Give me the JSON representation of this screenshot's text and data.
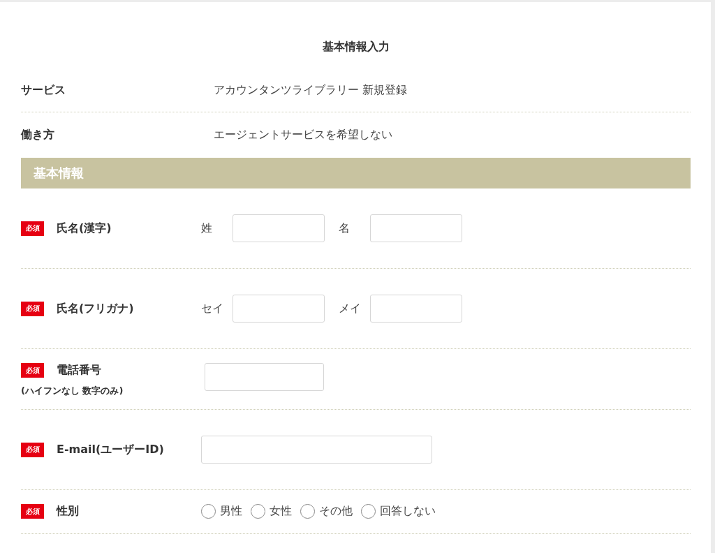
{
  "title": "基本情報入力",
  "info_rows": [
    {
      "label": "サービス",
      "value": "アカウンタンツライブラリー 新規登録"
    },
    {
      "label": "働き方",
      "value": "エージェントサービスを希望しない"
    }
  ],
  "section": {
    "title": "基本情報"
  },
  "fields": [
    {
      "kind": "name_pair",
      "badge": "必須",
      "label": "氏名(漢字)",
      "inputs": [
        {
          "prefix": "姓"
        },
        {
          "prefix": "名"
        }
      ]
    },
    {
      "kind": "name_pair",
      "badge": "必須",
      "label": "氏名(フリガナ)",
      "inputs": [
        {
          "prefix": "セイ"
        },
        {
          "prefix": "メイ"
        }
      ]
    },
    {
      "kind": "phone",
      "badge": "必須",
      "label": "電話番号",
      "note": "(ハイフンなし 数字のみ)"
    },
    {
      "kind": "email",
      "badge": "必須",
      "label": "E-mail(ユーザーID)"
    },
    {
      "kind": "radio",
      "badge": "必須",
      "label": "性別",
      "options": [
        {
          "label": "男性",
          "selected": false
        },
        {
          "label": "女性",
          "selected": false
        },
        {
          "label": "その他",
          "selected": false
        },
        {
          "label": "回答しない",
          "selected": false
        }
      ]
    }
  ]
}
